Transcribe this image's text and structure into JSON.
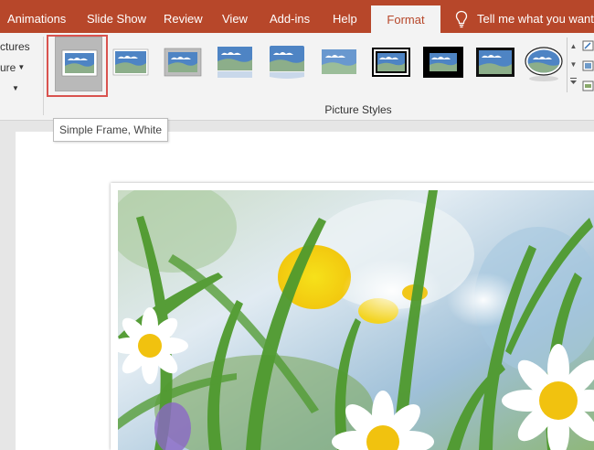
{
  "tabs": [
    {
      "label": "Animations",
      "active": false
    },
    {
      "label": "Slide Show",
      "active": false
    },
    {
      "label": "Review",
      "active": false
    },
    {
      "label": "View",
      "active": false
    },
    {
      "label": "Add-ins",
      "active": false
    },
    {
      "label": "Help",
      "active": false
    },
    {
      "label": "Format",
      "active": true
    }
  ],
  "tell_me": "Tell me what you want t",
  "left_tools": [
    "ctures",
    "ure",
    ""
  ],
  "gallery": {
    "group_label": "Picture Styles",
    "styles": [
      {
        "icon": "simple-frame-white-icon",
        "selected": true
      },
      {
        "icon": "soft-edge-icon",
        "selected": false
      },
      {
        "icon": "shadow-rectangle-icon",
        "selected": false
      },
      {
        "icon": "reflected-soft-edge-icon",
        "selected": false
      },
      {
        "icon": "reflected-rounded-icon",
        "selected": false
      },
      {
        "icon": "soft-edge-rectangle-icon",
        "selected": false
      },
      {
        "icon": "double-frame-black-icon",
        "selected": false
      },
      {
        "icon": "thick-matte-black-icon",
        "selected": false
      },
      {
        "icon": "simple-frame-black-icon",
        "selected": false
      },
      {
        "icon": "oval-icon",
        "selected": false
      }
    ]
  },
  "tooltip": "Simple Frame, White",
  "colors": {
    "ribbon_tab_bar": "#b7472a",
    "ribbon_body": "#f3f3f3",
    "selection_outline": "#d9534f"
  }
}
